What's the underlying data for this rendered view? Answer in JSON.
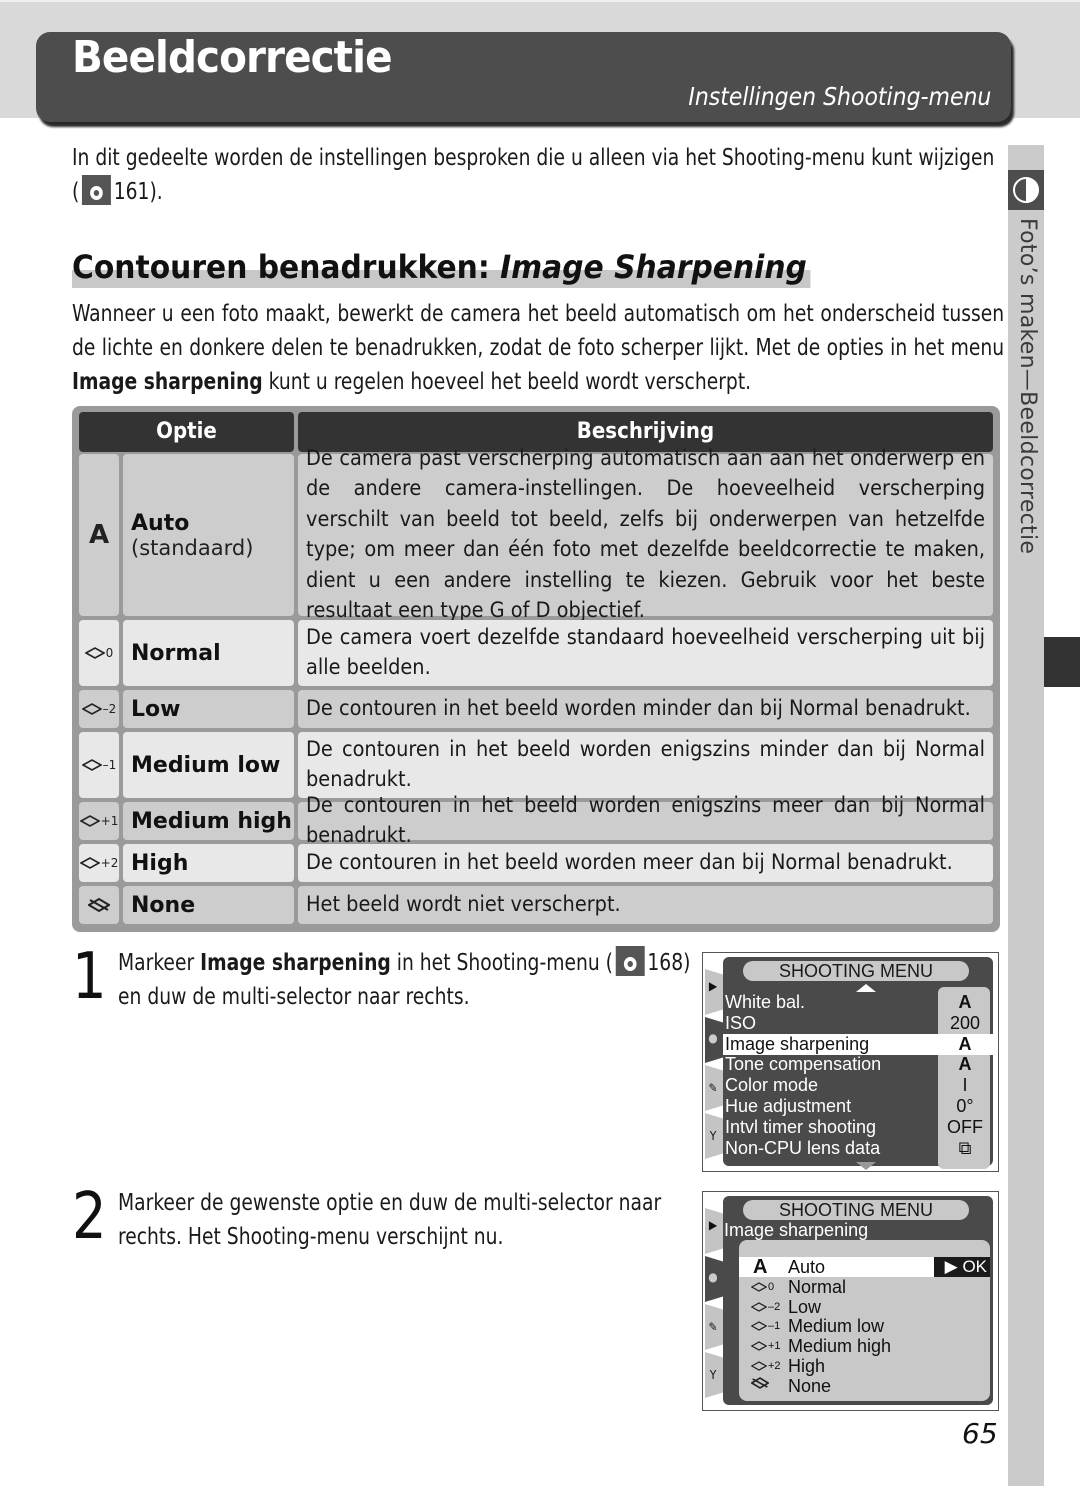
{
  "header": {
    "title": "Beeldcorrectie",
    "subtitle": "Instellingen Shooting-menu"
  },
  "side_tab": {
    "icon": "half-circle-contrast-icon",
    "label": "Foto’s maken—Beeldcorrectie"
  },
  "intro": {
    "text_before": "In dit gedeelte worden de instellingen besproken die u alleen via het Shooting-menu kunt wijzigen (",
    "ref_icon": "reference-eye-icon",
    "page_ref": "161",
    "text_after": ")."
  },
  "section": {
    "title_plain": "Contouren benadrukken: ",
    "title_italic": "Image Sharpening",
    "body_before": "Wanneer u een foto maakt, bewerkt de camera het beeld automatisch om het onderscheid tussen de lichte en donkere delen te benadrukken, zodat de foto scherper lijkt. Met de op­ties in het menu ",
    "body_bold": "Image sharpening",
    "body_after": " kunt u regelen hoeveel het beeld wordt verscherpt."
  },
  "table": {
    "headers": [
      "Optie",
      "Beschrijving"
    ],
    "rows": [
      {
        "icon": "A",
        "icon_name": "auto-a-icon",
        "name": "Auto",
        "sub": "(standaard)",
        "desc": "De camera past verscherping automatisch aan aan het onderwerp en de andere camera-instellingen. De hoeveelheid verscherping verschilt van beeld tot beeld, zelfs bij onderwerpen van hetzelfde type; om meer dan één foto met dezelfde beeldcorrectie te maken, dient u een andere instel­ling te kiezen. Gebruik voor het beste resultaat een type G of D objectief."
      },
      {
        "icon": "0",
        "icon_name": "sharpening-0-icon",
        "name": "Normal",
        "sub": "",
        "desc": "De camera voert dezelfde standaard hoeveelheid verscherping uit bij alle beelden."
      },
      {
        "icon": "–2",
        "icon_name": "sharpening-minus2-icon",
        "name": "Low",
        "sub": "",
        "desc": "De contouren in het beeld worden minder dan bij Normal benadrukt."
      },
      {
        "icon": "–1",
        "icon_name": "sharpening-minus1-icon",
        "name": "Medium low",
        "sub": "",
        "desc": "De contouren in het beeld worden enigszins minder dan bij Normal benadrukt."
      },
      {
        "icon": "+1",
        "icon_name": "sharpening-plus1-icon",
        "name": "Medium high",
        "sub": "",
        "desc": "De contouren in het beeld worden enigszins meer dan bij Normal benadrukt."
      },
      {
        "icon": "+2",
        "icon_name": "sharpening-plus2-icon",
        "name": "High",
        "sub": "",
        "desc": "De contouren in het beeld worden meer dan bij Normal benadrukt."
      },
      {
        "icon": "",
        "icon_name": "sharpening-none-icon",
        "name": "None",
        "sub": "",
        "desc": "Het beeld wordt niet verscherpt."
      }
    ]
  },
  "steps": [
    {
      "number": "1",
      "text_before": "Markeer ",
      "bold": "Image sharpening",
      "text_mid": " in het Shooting-menu (",
      "page_ref": "168",
      "text_after": ") en duw de multi-selector naar rechts."
    },
    {
      "number": "2",
      "text": "Markeer de gewenste optie en duw de multi-selec­tor naar rechts. Het Shooting-menu verschijnt nu."
    }
  ],
  "lcd1": {
    "header": "SHOOTING MENU",
    "items": [
      {
        "label": "White bal.",
        "value": "A"
      },
      {
        "label": "ISO",
        "value": "200"
      },
      {
        "label": "Image sharpening",
        "value": "A",
        "selected": true
      },
      {
        "label": "Tone compensation",
        "value": "A"
      },
      {
        "label": "Color mode",
        "value": "I"
      },
      {
        "label": "Hue adjustment",
        "value": "0°"
      },
      {
        "label": "Intvl timer shooting",
        "value": "OFF"
      },
      {
        "label": "Non-CPU lens data",
        "value": "⧉"
      }
    ],
    "rail_icons": [
      "playback-icon",
      "camera-icon",
      "pencil-icon",
      "wrench-icon"
    ]
  },
  "lcd2": {
    "header": "SHOOTING MENU",
    "subtitle": "Image sharpening",
    "ok_label": "▶ OK",
    "options": [
      {
        "icon": "A",
        "label": "Auto",
        "selected": true
      },
      {
        "icon": "0",
        "label": "Normal"
      },
      {
        "icon": "–2",
        "label": "Low"
      },
      {
        "icon": "–1",
        "label": "Medium low"
      },
      {
        "icon": "+1",
        "label": "Medium high"
      },
      {
        "icon": "+2",
        "label": "High"
      },
      {
        "icon": "",
        "label": "None"
      }
    ]
  },
  "page_number": "65"
}
